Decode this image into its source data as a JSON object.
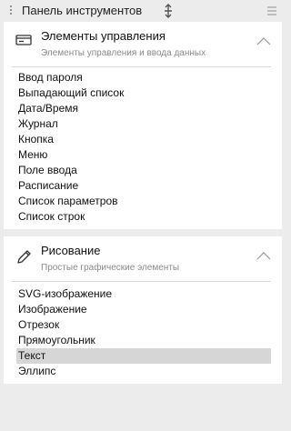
{
  "panel": {
    "title": "Панель инструментов"
  },
  "groups": [
    {
      "title": "Элементы управления",
      "subtitle": "Элементы управления и ввода данных",
      "icon": "control-element-icon",
      "items": [
        "Ввод пароля",
        "Выпадающий список",
        "Дата/Время",
        "Журнал",
        "Кнопка",
        "Меню",
        "Поле ввода",
        "Расписание",
        "Список параметров",
        "Список строк"
      ]
    },
    {
      "title": "Рисование",
      "subtitle": "Простые графические элементы",
      "icon": "pencil-icon",
      "items": [
        "SVG-изображение",
        "Изображение",
        "Отрезок",
        "Прямоугольник",
        "Текст",
        "Эллипс"
      ],
      "selected_item": "Текст"
    }
  ],
  "colors": {
    "background": "#ececec",
    "card": "#ffffff",
    "selected": "#d6d6d6"
  }
}
